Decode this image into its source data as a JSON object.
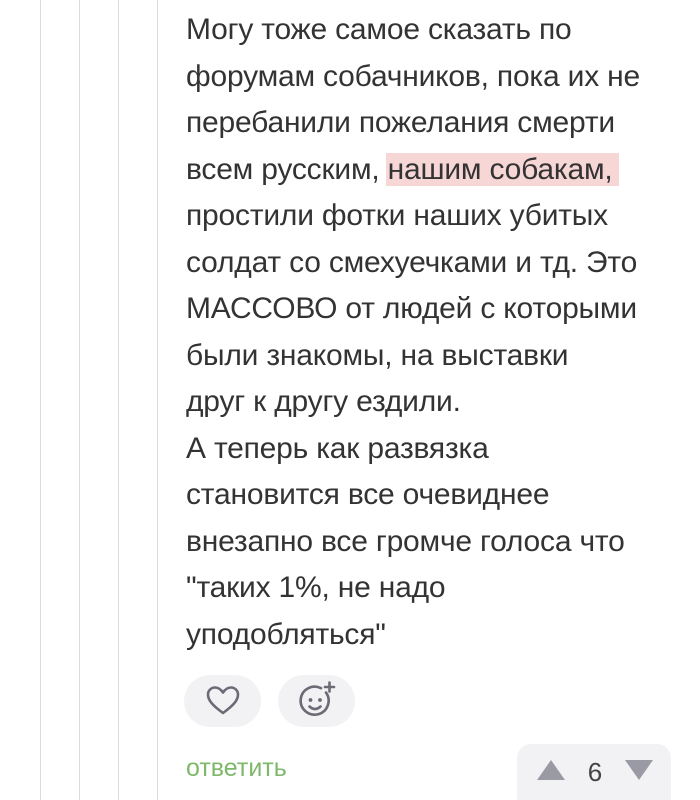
{
  "comment": {
    "lines": [
      "Могу тоже самое сказать по",
      "форумам собачников, пока их не",
      "перебанили пожелания смерти",
      "всем русским, ",
      "нашим собакам,",
      "простили фотки наших убитых",
      "солдат со смехуечками и тд. Это",
      "МАССОВО от людей с которыми",
      "были знакомы, на выставки",
      "друг к другу ездили.",
      "А теперь как развязка",
      "становится все очевиднее",
      "внезапно все громче голоса что",
      "\"таких 1%, не надо",
      "уподобляться\""
    ]
  },
  "actions": {
    "like_icon": "heart-icon",
    "emoji_icon": "add-emoji-icon",
    "reply_label": "ответить"
  },
  "rating": {
    "count": "6",
    "up_icon": "triangle-up-icon",
    "down_icon": "triangle-down-icon"
  },
  "colors": {
    "text": "#333333",
    "reply_green": "#7eb86a",
    "highlight": "#f7d6d6",
    "button_bg": "#f2f2f5",
    "icon_gray": "#9a9aa5"
  }
}
